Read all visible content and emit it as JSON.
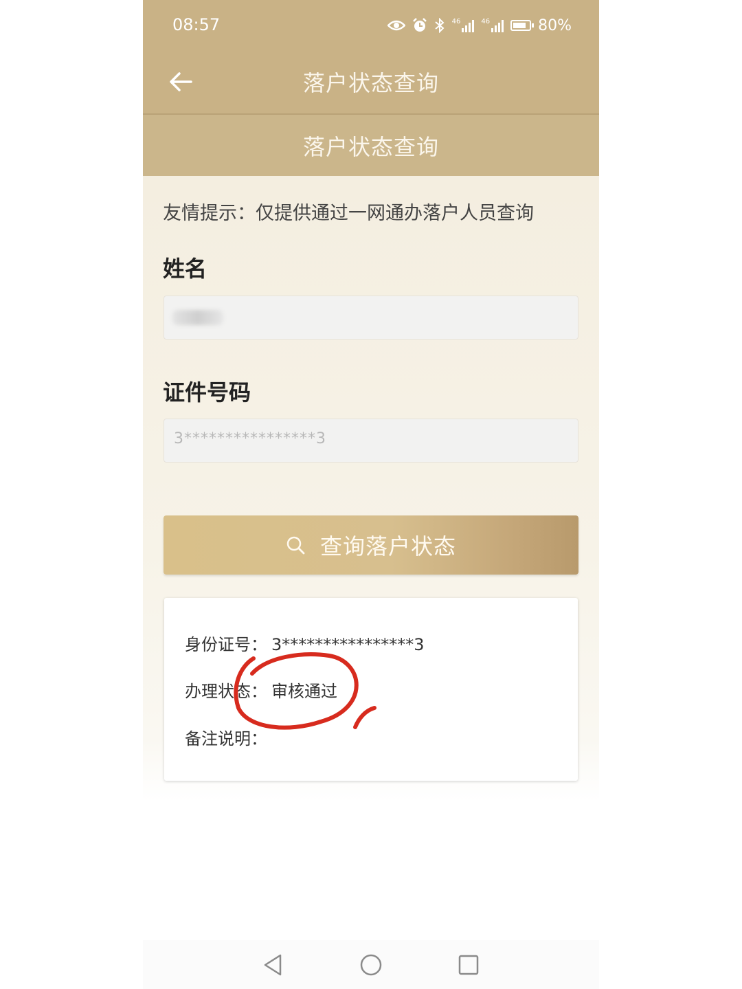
{
  "status_bar": {
    "time": "08:57",
    "battery": "80%",
    "network_1": "46",
    "network_2": "46",
    "icons": [
      "eye-icon",
      "alarm-icon",
      "bluetooth-icon",
      "signal-icon",
      "signal-icon",
      "battery-icon"
    ]
  },
  "app_bar": {
    "title": "落户状态查询",
    "back_icon": "arrow-left-icon"
  },
  "sub_header": {
    "title": "落户状态查询"
  },
  "form": {
    "tip": "友情提示：仅提供通过一网通办落户人员查询",
    "name_label": "姓名",
    "id_label": "证件号码",
    "id_value": "3****************3",
    "query_button": "查询落户状态",
    "query_icon": "search-icon"
  },
  "result": {
    "id_label": "身份证号：",
    "id_value": "3****************3",
    "status_label": "办理状态：",
    "status_value": "审核通过",
    "remark_label": "备注说明："
  },
  "nav_bar": {
    "icons": [
      "back-triangle-icon",
      "home-circle-icon",
      "recent-square-icon"
    ]
  },
  "colors": {
    "header": "#c9b286",
    "button": "#d7bf8e",
    "annotation": "#d72b1e"
  }
}
